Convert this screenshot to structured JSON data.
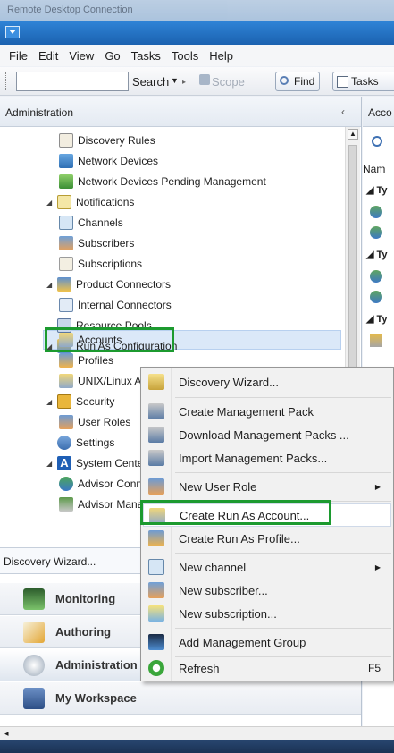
{
  "window": {
    "title": "Remote Desktop Connection"
  },
  "menu": [
    "File",
    "Edit",
    "View",
    "Go",
    "Tasks",
    "Tools",
    "Help"
  ],
  "toolbar": {
    "search_label": "Search",
    "scope_label": "Scope",
    "find_label": "Find",
    "tasks_label": "Tasks"
  },
  "left_pane": {
    "header": "Administration",
    "collapse_glyph": "‹",
    "tree": [
      "Discovery Rules",
      "Network Devices",
      "Network Devices Pending Management",
      "Notifications",
      "Channels",
      "Subscribers",
      "Subscriptions",
      "Product Connectors",
      "Internal Connectors",
      "Resource Pools",
      "Run As Configuration",
      "Accounts",
      "Profiles",
      "UNIX/Linux Ac",
      "Security",
      "User Roles",
      "Settings",
      "System Center A",
      "Advisor Conn",
      "Advisor Mana"
    ],
    "tasks_link": "Discovery Wizard...",
    "wunderbar": [
      "Monitoring",
      "Authoring",
      "Administration",
      "My Workspace"
    ]
  },
  "right_pane": {
    "header": "Acco",
    "name_col": "Nam",
    "group_marker": "Ty"
  },
  "context_menu": {
    "items": [
      {
        "label": "Discovery Wizard...",
        "icon": "wizard-icon"
      },
      {
        "label": "Create Management Pack",
        "icon": "management-pack-icon"
      },
      {
        "label": "Download Management Packs ...",
        "icon": "download-pack-icon"
      },
      {
        "label": "Import Management Packs...",
        "icon": "import-pack-icon"
      },
      {
        "label": "New User Role",
        "icon": "user-role-icon",
        "submenu": true
      },
      {
        "label": "Create Run As Account...",
        "icon": "run-as-account-icon"
      },
      {
        "label": "Create Run As Profile...",
        "icon": "run-as-profile-icon"
      },
      {
        "label": "New channel",
        "icon": "channel-icon",
        "submenu": true
      },
      {
        "label": "New subscriber...",
        "icon": "subscriber-icon"
      },
      {
        "label": "New subscription...",
        "icon": "subscription-icon"
      },
      {
        "label": "Add Management Group",
        "icon": "management-group-icon"
      },
      {
        "label": "Refresh",
        "icon": "refresh-icon",
        "shortcut": "F5"
      }
    ]
  },
  "colors": {
    "highlight_box": "#1c9a2f",
    "selection": "#dbe8f8",
    "titlebar": "#2f83d6"
  }
}
